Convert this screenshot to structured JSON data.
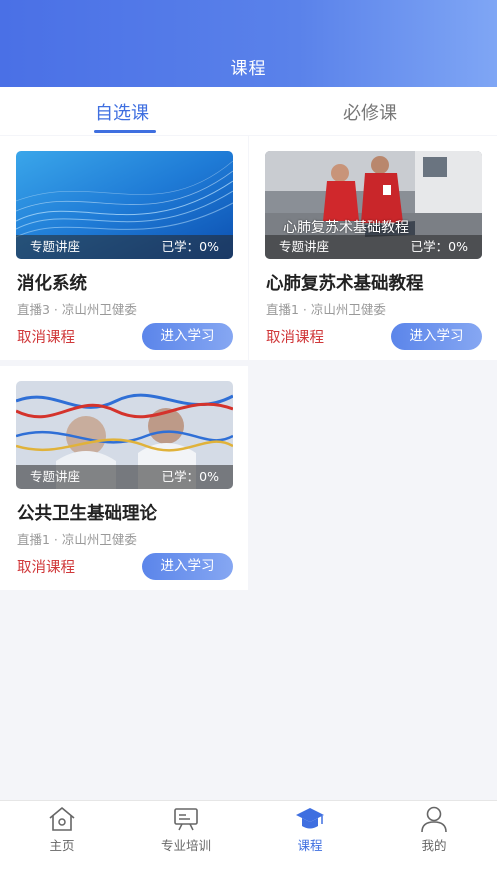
{
  "header": {
    "title": "课程"
  },
  "tabs": [
    {
      "label": "自选课",
      "active": true
    },
    {
      "label": "必修课",
      "active": false
    }
  ],
  "courses": [
    {
      "title": "消化系统",
      "tag": "专题讲座",
      "progress": "已学：0%",
      "meta": "直播3 · 凉山州卫健委",
      "cancel": "取消课程",
      "enter": "进入学习",
      "thumb_caption": ""
    },
    {
      "title": "心肺复苏术基础教程",
      "tag": "专题讲座",
      "progress": "已学：0%",
      "meta": "直播1 · 凉山州卫健委",
      "cancel": "取消课程",
      "enter": "进入学习",
      "thumb_caption": "心肺复苏术基础教程"
    },
    {
      "title": "公共卫生基础理论",
      "tag": "专题讲座",
      "progress": "已学：0%",
      "meta": "直播1 · 凉山州卫健委",
      "cancel": "取消课程",
      "enter": "进入学习",
      "thumb_caption": ""
    }
  ],
  "tabbar": [
    {
      "label": "主页",
      "icon": "home-icon",
      "active": false
    },
    {
      "label": "专业培训",
      "icon": "presentation-board-icon",
      "active": false
    },
    {
      "label": "课程",
      "icon": "graduation-cap-icon",
      "active": true
    },
    {
      "label": "我的",
      "icon": "user-icon",
      "active": false
    }
  ],
  "colors": {
    "primary": "#3f6fe0",
    "cancel": "#d0383a",
    "background": "#f4f5f9"
  }
}
